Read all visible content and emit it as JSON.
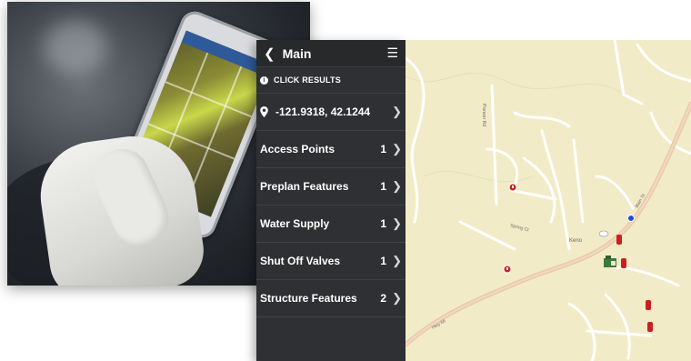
{
  "panel": {
    "title": "Main",
    "section_title": "CLICK RESULTS",
    "coordinates": "-121.9318, 42.1244",
    "results": [
      {
        "label": "Access Points",
        "count": "1"
      },
      {
        "label": "Preplan Features",
        "count": "1"
      },
      {
        "label": "Water Supply",
        "count": "1"
      },
      {
        "label": "Shut Off Valves",
        "count": "1"
      },
      {
        "label": "Structure Features",
        "count": "2"
      }
    ]
  },
  "icons": {
    "back": "chevron-left-icon",
    "menu": "hamburger-menu-icon",
    "info": "info-icon",
    "pin": "location-pin-icon",
    "row_chevron": "chevron-right-icon"
  },
  "map": {
    "street_labels": [
      "Keno",
      "Spring Ct",
      "Main St",
      "Hwy 66",
      "Pioneer Rd"
    ],
    "colors": {
      "background": "#f2ebc7",
      "highway": "#e8c7a8",
      "street": "#ffffff",
      "marker_red": "#cc1f1f",
      "marker_blue": "#1f4fd1"
    }
  }
}
